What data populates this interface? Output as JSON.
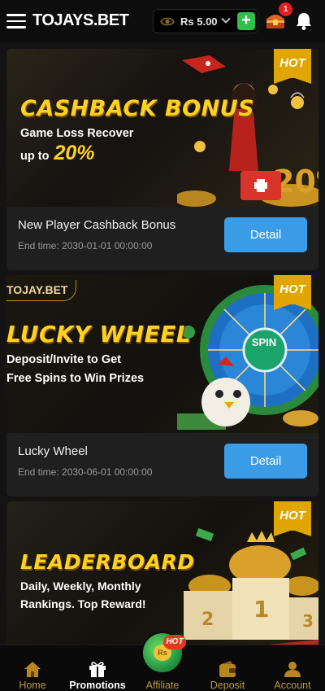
{
  "header": {
    "logo": "TOJAYS.BET",
    "balance": "Rs 5.00",
    "chest_badge": "1"
  },
  "promotions": [
    {
      "banner_title": "CASHBACK BONUS",
      "banner_line1": "Game Loss Recover",
      "banner_line2": "up to",
      "banner_percent": "20%",
      "hot_label": "HOT",
      "title": "New Player Cashback Bonus",
      "end_time": "End time: 2030-01-01 00:00:00",
      "button": "Detail"
    },
    {
      "brand_tag": "TOJAY.BET",
      "banner_title": "LUCKY WHEEL",
      "banner_line1": "Deposit/Invite to Get",
      "banner_line2": "Free Spins to Win Prizes",
      "spin_label": "SPIN",
      "hot_label": "HOT",
      "title": "Lucky Wheel",
      "end_time": "End time: 2030-06-01 00:00:00",
      "button": "Detail"
    },
    {
      "banner_title": "LEADERBOARD",
      "banner_line1": "Daily, Weekly, Monthly",
      "banner_line2": "Rankings. Top Reward!",
      "hot_label": "HOT",
      "podium": [
        "2",
        "1",
        "3"
      ]
    }
  ],
  "bottom_nav": [
    {
      "label": "Home",
      "icon": "home-icon"
    },
    {
      "label": "Promotions",
      "icon": "gift-icon"
    },
    {
      "label": "Affiliate",
      "icon": "affiliate-coin-icon"
    },
    {
      "label": "Deposit",
      "icon": "wallet-icon"
    },
    {
      "label": "Account",
      "icon": "account-icon"
    }
  ],
  "affiliate_hot": "HOT",
  "colors": {
    "accent_gold": "#ffd21f",
    "detail_button": "#3a9be6",
    "plus_button": "#2fbf4a",
    "hot_ribbon": "#e0a500",
    "nav_label": "#b89a3a"
  }
}
